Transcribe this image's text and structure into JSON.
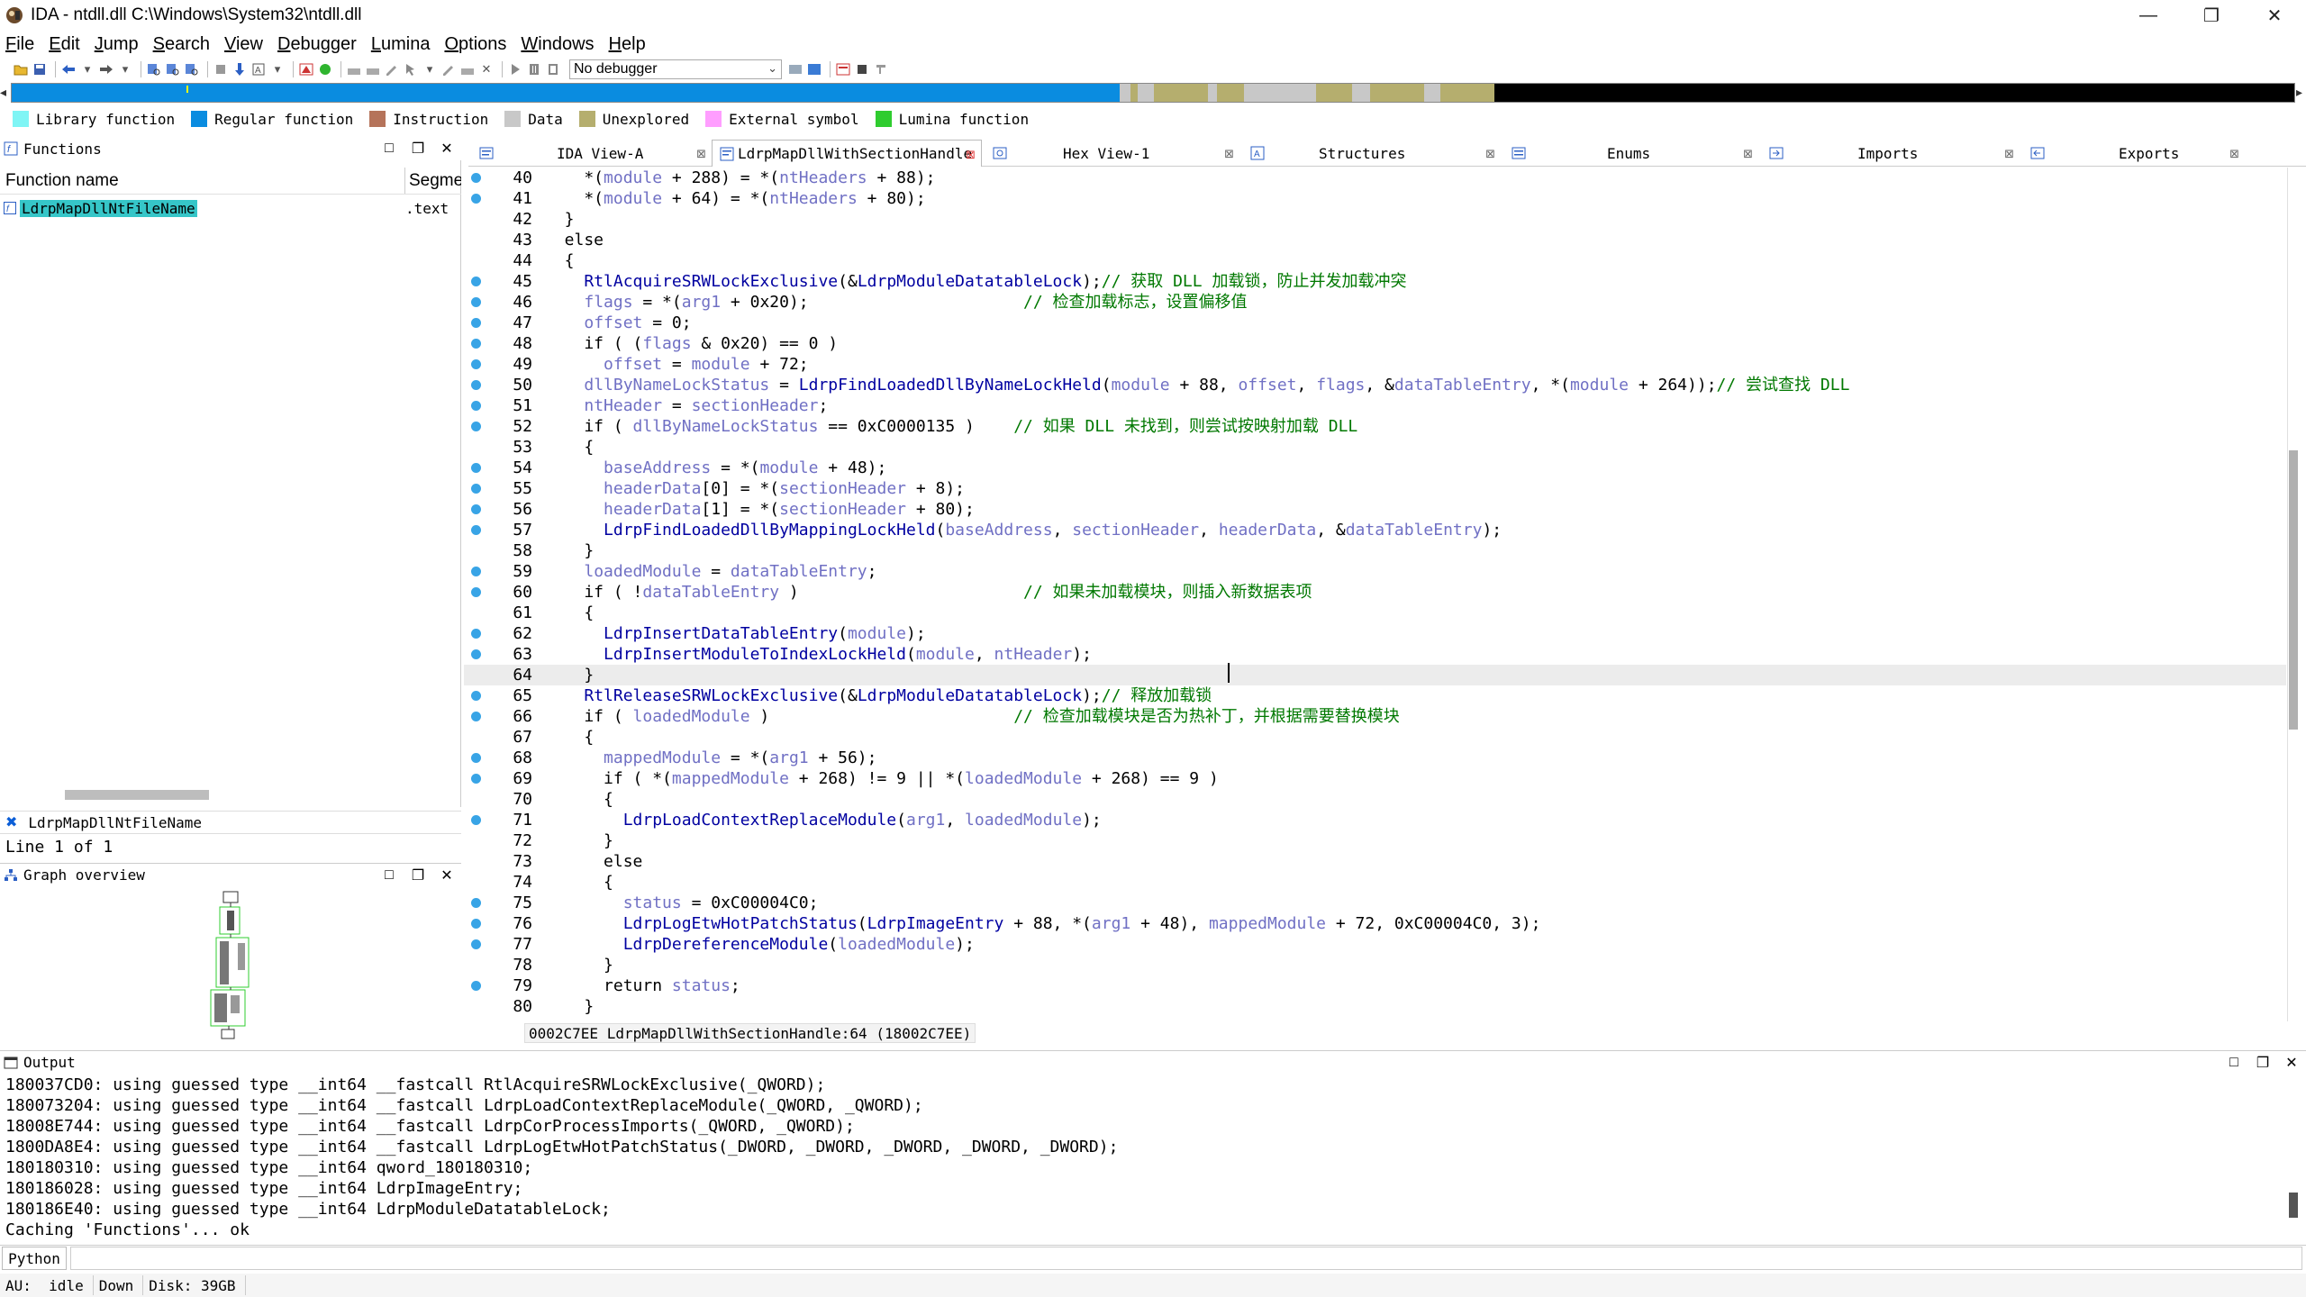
{
  "window": {
    "title": "IDA - ntdll.dll C:\\Windows\\System32\\ntdll.dll",
    "minimize_glyph": "—",
    "maximize_glyph": "❐",
    "close_glyph": "✕"
  },
  "menu": [
    "File",
    "Edit",
    "Jump",
    "Search",
    "View",
    "Debugger",
    "Lumina",
    "Options",
    "Windows",
    "Help"
  ],
  "toolbar": {
    "debugger_label": "No debugger"
  },
  "navband": {
    "colors": {
      "regular": "#0a8ce0",
      "data": "#c8c8c8",
      "unexplored": "#b5ae6e",
      "black": "#000000"
    }
  },
  "legend": [
    {
      "label": "Library function",
      "color": "#7ff5f5"
    },
    {
      "label": "Regular function",
      "color": "#0a8ce0"
    },
    {
      "label": "Instruction",
      "color": "#b5735a"
    },
    {
      "label": "Data",
      "color": "#c8c8c8"
    },
    {
      "label": "Unexplored",
      "color": "#b5ae6e"
    },
    {
      "label": "External symbol",
      "color": "#ff9eff"
    },
    {
      "label": "Lumina function",
      "color": "#2fcc2f"
    }
  ],
  "functions": {
    "title": "Functions",
    "col_name": "Function name",
    "col_segment": "Segme",
    "rows": [
      {
        "name": "LdrpMapDllNtFileName",
        "segment": ".text"
      }
    ],
    "filter_text": "LdrpMapDllNtFileName",
    "status": "Line 1 of 1"
  },
  "graph_overview": {
    "title": "Graph overview"
  },
  "tabs": [
    {
      "label": "IDA View-A",
      "icon": "ida-view-icon",
      "active": false
    },
    {
      "label": "LdrpMapDllWithSectionHandle",
      "icon": "pseudocode-icon",
      "active": true
    },
    {
      "label": "Hex View-1",
      "icon": "hex-view-icon",
      "active": false
    },
    {
      "label": "Structures",
      "icon": "structures-icon",
      "active": false
    },
    {
      "label": "Enums",
      "icon": "enums-icon",
      "active": false
    },
    {
      "label": "Imports",
      "icon": "imports-icon",
      "active": false
    },
    {
      "label": "Exports",
      "icon": "exports-icon",
      "active": false
    }
  ],
  "code": {
    "lines": [
      {
        "n": 40,
        "bp": true,
        "t": [
          [
            "    *(",
            "k"
          ],
          [
            "module",
            "v"
          ],
          [
            " + 288) = *(",
            "k"
          ],
          [
            "ntHeaders",
            "v"
          ],
          [
            " + 88);",
            "k"
          ]
        ]
      },
      {
        "n": 41,
        "bp": true,
        "t": [
          [
            "    *(",
            "k"
          ],
          [
            "module",
            "v"
          ],
          [
            " + 64) = *(",
            "k"
          ],
          [
            "ntHeaders",
            "v"
          ],
          [
            " + 80);",
            "k"
          ]
        ]
      },
      {
        "n": 42,
        "bp": false,
        "t": [
          [
            "  }",
            "k"
          ]
        ]
      },
      {
        "n": 43,
        "bp": false,
        "t": [
          [
            "  else",
            "k"
          ]
        ]
      },
      {
        "n": 44,
        "bp": false,
        "t": [
          [
            "  {",
            "k"
          ]
        ]
      },
      {
        "n": 45,
        "bp": true,
        "t": [
          [
            "    ",
            "k"
          ],
          [
            "RtlAcquireSRWLockExclusive",
            "f"
          ],
          [
            "(&",
            "k"
          ],
          [
            "LdrpModuleDatatableLock",
            "f"
          ],
          [
            ");",
            "k"
          ],
          [
            "// 获取 DLL 加载锁，防止并发加载冲突",
            "c"
          ]
        ]
      },
      {
        "n": 46,
        "bp": true,
        "t": [
          [
            "    ",
            "k"
          ],
          [
            "flags",
            "v"
          ],
          [
            " = *(",
            "k"
          ],
          [
            "arg1",
            "v"
          ],
          [
            " + 0x20);                      ",
            "k"
          ],
          [
            "// 检查加载标志，设置偏移值",
            "c"
          ]
        ]
      },
      {
        "n": 47,
        "bp": true,
        "t": [
          [
            "    ",
            "k"
          ],
          [
            "offset",
            "v"
          ],
          [
            " = 0;",
            "k"
          ]
        ]
      },
      {
        "n": 48,
        "bp": true,
        "t": [
          [
            "    if ( (",
            "k"
          ],
          [
            "flags",
            "v"
          ],
          [
            " & 0x20) == 0 )",
            "k"
          ]
        ]
      },
      {
        "n": 49,
        "bp": true,
        "t": [
          [
            "      ",
            "k"
          ],
          [
            "offset",
            "v"
          ],
          [
            " = ",
            "k"
          ],
          [
            "module",
            "v"
          ],
          [
            " + 72;",
            "k"
          ]
        ]
      },
      {
        "n": 50,
        "bp": true,
        "t": [
          [
            "    ",
            "k"
          ],
          [
            "dllByNameLockStatus",
            "v"
          ],
          [
            " = ",
            "k"
          ],
          [
            "LdrpFindLoadedDllByNameLockHeld",
            "f"
          ],
          [
            "(",
            "k"
          ],
          [
            "module",
            "v"
          ],
          [
            " + 88, ",
            "k"
          ],
          [
            "offset",
            "v"
          ],
          [
            ", ",
            "k"
          ],
          [
            "flags",
            "v"
          ],
          [
            ", &",
            "k"
          ],
          [
            "dataTableEntry",
            "v"
          ],
          [
            ", *(",
            "k"
          ],
          [
            "module",
            "v"
          ],
          [
            " + 264));",
            "k"
          ],
          [
            "// 尝试查找 DLL",
            "c"
          ]
        ]
      },
      {
        "n": 51,
        "bp": true,
        "t": [
          [
            "    ",
            "k"
          ],
          [
            "ntHeader",
            "v"
          ],
          [
            " = ",
            "k"
          ],
          [
            "sectionHeader",
            "v"
          ],
          [
            ";",
            "k"
          ]
        ]
      },
      {
        "n": 52,
        "bp": true,
        "t": [
          [
            "    if ( ",
            "k"
          ],
          [
            "dllByNameLockStatus",
            "v"
          ],
          [
            " == 0xC0000135 )    ",
            "k"
          ],
          [
            "// 如果 DLL 未找到，则尝试按映射加载 DLL",
            "c"
          ]
        ]
      },
      {
        "n": 53,
        "bp": false,
        "t": [
          [
            "    {",
            "k"
          ]
        ]
      },
      {
        "n": 54,
        "bp": true,
        "t": [
          [
            "      ",
            "k"
          ],
          [
            "baseAddress",
            "v"
          ],
          [
            " = *(",
            "k"
          ],
          [
            "module",
            "v"
          ],
          [
            " + 48);",
            "k"
          ]
        ]
      },
      {
        "n": 55,
        "bp": true,
        "t": [
          [
            "      ",
            "k"
          ],
          [
            "headerData",
            "v"
          ],
          [
            "[0] = *(",
            "k"
          ],
          [
            "sectionHeader",
            "v"
          ],
          [
            " + 8);",
            "k"
          ]
        ]
      },
      {
        "n": 56,
        "bp": true,
        "t": [
          [
            "      ",
            "k"
          ],
          [
            "headerData",
            "v"
          ],
          [
            "[1] = *(",
            "k"
          ],
          [
            "sectionHeader",
            "v"
          ],
          [
            " + 80);",
            "k"
          ]
        ]
      },
      {
        "n": 57,
        "bp": true,
        "t": [
          [
            "      ",
            "k"
          ],
          [
            "LdrpFindLoadedDllByMappingLockHeld",
            "f"
          ],
          [
            "(",
            "k"
          ],
          [
            "baseAddress",
            "v"
          ],
          [
            ", ",
            "k"
          ],
          [
            "sectionHeader",
            "v"
          ],
          [
            ", ",
            "k"
          ],
          [
            "headerData",
            "v"
          ],
          [
            ", &",
            "k"
          ],
          [
            "dataTableEntry",
            "v"
          ],
          [
            ");",
            "k"
          ]
        ]
      },
      {
        "n": 58,
        "bp": false,
        "t": [
          [
            "    }",
            "k"
          ]
        ]
      },
      {
        "n": 59,
        "bp": true,
        "t": [
          [
            "    ",
            "k"
          ],
          [
            "loadedModule",
            "v"
          ],
          [
            " = ",
            "k"
          ],
          [
            "dataTableEntry",
            "v"
          ],
          [
            ";",
            "k"
          ]
        ]
      },
      {
        "n": 60,
        "bp": true,
        "t": [
          [
            "    if ( !",
            "k"
          ],
          [
            "dataTableEntry",
            "v"
          ],
          [
            " )                       ",
            "k"
          ],
          [
            "// 如果未加载模块，则插入新数据表项",
            "c"
          ]
        ]
      },
      {
        "n": 61,
        "bp": false,
        "t": [
          [
            "    {",
            "k"
          ]
        ]
      },
      {
        "n": 62,
        "bp": true,
        "t": [
          [
            "      ",
            "k"
          ],
          [
            "LdrpInsertDataTableEntry",
            "f"
          ],
          [
            "(",
            "k"
          ],
          [
            "module",
            "v"
          ],
          [
            ");",
            "k"
          ]
        ]
      },
      {
        "n": 63,
        "bp": true,
        "t": [
          [
            "      ",
            "k"
          ],
          [
            "LdrpInsertModuleToIndexLockHeld",
            "f"
          ],
          [
            "(",
            "k"
          ],
          [
            "module",
            "v"
          ],
          [
            ", ",
            "k"
          ],
          [
            "ntHeader",
            "v"
          ],
          [
            ");",
            "k"
          ]
        ]
      },
      {
        "n": 64,
        "bp": false,
        "cur": true,
        "t": [
          [
            "    }",
            "k"
          ]
        ]
      },
      {
        "n": 65,
        "bp": true,
        "t": [
          [
            "    ",
            "k"
          ],
          [
            "RtlReleaseSRWLockExclusive",
            "f"
          ],
          [
            "(&",
            "k"
          ],
          [
            "LdrpModuleDatatableLock",
            "f"
          ],
          [
            ");",
            "k"
          ],
          [
            "// 释放加载锁",
            "c"
          ]
        ]
      },
      {
        "n": 66,
        "bp": true,
        "t": [
          [
            "    if ( ",
            "k"
          ],
          [
            "loadedModule",
            "v"
          ],
          [
            " )                         ",
            "k"
          ],
          [
            "// 检查加载模块是否为热补丁，并根据需要替换模块",
            "c"
          ]
        ]
      },
      {
        "n": 67,
        "bp": false,
        "t": [
          [
            "    {",
            "k"
          ]
        ]
      },
      {
        "n": 68,
        "bp": true,
        "t": [
          [
            "      ",
            "k"
          ],
          [
            "mappedModule",
            "v"
          ],
          [
            " = *(",
            "k"
          ],
          [
            "arg1",
            "v"
          ],
          [
            " + 56);",
            "k"
          ]
        ]
      },
      {
        "n": 69,
        "bp": true,
        "t": [
          [
            "      if ( *(",
            "k"
          ],
          [
            "mappedModule",
            "v"
          ],
          [
            " + 268) != 9 || *(",
            "k"
          ],
          [
            "loadedModule",
            "v"
          ],
          [
            " + 268) == 9 )",
            "k"
          ]
        ]
      },
      {
        "n": 70,
        "bp": false,
        "t": [
          [
            "      {",
            "k"
          ]
        ]
      },
      {
        "n": 71,
        "bp": true,
        "t": [
          [
            "        ",
            "k"
          ],
          [
            "LdrpLoadContextReplaceModule",
            "f"
          ],
          [
            "(",
            "k"
          ],
          [
            "arg1",
            "v"
          ],
          [
            ", ",
            "k"
          ],
          [
            "loadedModule",
            "v"
          ],
          [
            ");",
            "k"
          ]
        ]
      },
      {
        "n": 72,
        "bp": false,
        "t": [
          [
            "      }",
            "k"
          ]
        ]
      },
      {
        "n": 73,
        "bp": false,
        "t": [
          [
            "      else",
            "k"
          ]
        ]
      },
      {
        "n": 74,
        "bp": false,
        "t": [
          [
            "      {",
            "k"
          ]
        ]
      },
      {
        "n": 75,
        "bp": true,
        "t": [
          [
            "        ",
            "k"
          ],
          [
            "status",
            "v"
          ],
          [
            " = 0xC00004C0;",
            "k"
          ]
        ]
      },
      {
        "n": 76,
        "bp": true,
        "t": [
          [
            "        ",
            "k"
          ],
          [
            "LdrpLogEtwHotPatchStatus",
            "f"
          ],
          [
            "(",
            "k"
          ],
          [
            "LdrpImageEntry",
            "f"
          ],
          [
            " + 88, *(",
            "k"
          ],
          [
            "arg1",
            "v"
          ],
          [
            " + 48), ",
            "k"
          ],
          [
            "mappedModule",
            "v"
          ],
          [
            " + 72, 0xC00004C0, 3);",
            "k"
          ]
        ]
      },
      {
        "n": 77,
        "bp": true,
        "t": [
          [
            "        ",
            "k"
          ],
          [
            "LdrpDereferenceModule",
            "f"
          ],
          [
            "(",
            "k"
          ],
          [
            "loadedModule",
            "v"
          ],
          [
            ");",
            "k"
          ]
        ]
      },
      {
        "n": 78,
        "bp": false,
        "t": [
          [
            "      }",
            "k"
          ]
        ]
      },
      {
        "n": 79,
        "bp": true,
        "t": [
          [
            "      return ",
            "k"
          ],
          [
            "status",
            "v"
          ],
          [
            ";",
            "k"
          ]
        ]
      },
      {
        "n": 80,
        "bp": false,
        "t": [
          [
            "    }",
            "k"
          ]
        ]
      }
    ],
    "status_text": "0002C7EE LdrpMapDllWithSectionHandle:64 (18002C7EE)"
  },
  "output": {
    "title": "Output",
    "lines": [
      "180037CD0: using guessed type __int64 __fastcall RtlAcquireSRWLockExclusive(_QWORD);",
      "180073204: using guessed type __int64 __fastcall LdrpLoadContextReplaceModule(_QWORD, _QWORD);",
      "18008E744: using guessed type __int64 __fastcall LdrpCorProcessImports(_QWORD, _QWORD);",
      "1800DA8E4: using guessed type __int64 __fastcall LdrpLogEtwHotPatchStatus(_DWORD, _DWORD, _DWORD, _DWORD, _DWORD);",
      "180180310: using guessed type __int64 qword_180180310;",
      "180186028: using guessed type __int64 LdrpImageEntry;",
      "180186E40: using guessed type __int64 LdrpModuleDatatableLock;",
      "Caching 'Functions'... ok"
    ],
    "python_label": "Python"
  },
  "statusbar": {
    "au_label": "AU:",
    "au_value": "idle",
    "direction": "Down",
    "disk": "Disk: 39GB"
  }
}
